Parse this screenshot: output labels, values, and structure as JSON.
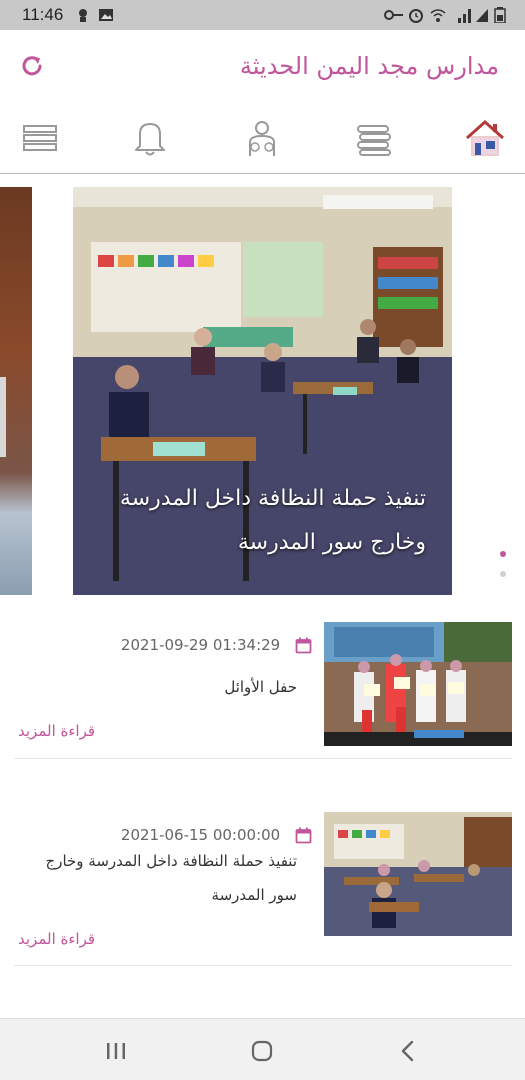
{
  "status_bar": {
    "time": "11:46"
  },
  "header": {
    "title": "مدارس مجد اليمن الحديثة",
    "refresh_icon": "refresh-icon"
  },
  "tabs": [
    {
      "name": "home",
      "icon": "home-icon"
    },
    {
      "name": "books",
      "icon": "books-icon"
    },
    {
      "name": "teacher",
      "icon": "teacher-icon"
    },
    {
      "name": "notifications",
      "icon": "bell-icon"
    },
    {
      "name": "menu",
      "icon": "menu-icon"
    }
  ],
  "carousel": {
    "caption": "تنفيذ حملة النظافة داخل المدرسة وخارج سور المدرسة",
    "active_dot": 0,
    "dot_count": 2
  },
  "news": [
    {
      "date": "2021-09-29 01:34:29",
      "title": "حفل الأوائل",
      "read_more": "قراءة المزيد"
    },
    {
      "date": "2021-06-15 00:00:00",
      "title": "تنفيذ حملة النظافة داخل المدرسة وخارج سور المدرسة",
      "read_more": "قراءة المزيد"
    }
  ],
  "colors": {
    "accent": "#c0569b",
    "status_bar": "#c8c8c8",
    "divider": "#bdbdbd"
  }
}
